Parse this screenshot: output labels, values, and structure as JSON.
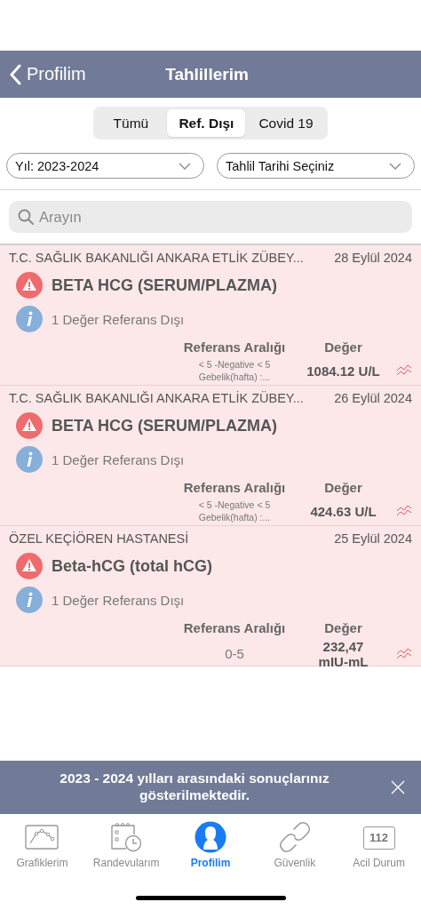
{
  "nav": {
    "back_label": "Profilim",
    "title": "Tahlillerim"
  },
  "segments": [
    {
      "label": "Tümü",
      "selected": false
    },
    {
      "label": "Ref. Dışı",
      "selected": true
    },
    {
      "label": "Covid 19",
      "selected": false
    }
  ],
  "filters": [
    {
      "value": "Yıl: 2023-2024"
    },
    {
      "value": "Tahlil Tarihi Seçiniz"
    }
  ],
  "search": {
    "placeholder": "Arayın"
  },
  "results": [
    {
      "hospital": "T.C. SAĞLIK BAKANLIĞI ANKARA ETLİK ZÜBEY...",
      "date": "28 Eylül 2024",
      "test": "BETA HCG (SERUM/PLAZMA)",
      "note": "1 Değer Referans Dışı",
      "ref_header": "Referans Aralığı",
      "value_header": "Değer",
      "ref_lines": [
        "< 5 -Negative < 5",
        "Gebelik(hafta) :..."
      ],
      "value_lines": [
        "1084.12 U/L"
      ]
    },
    {
      "hospital": "T.C. SAĞLIK BAKANLIĞI ANKARA ETLİK ZÜBEY...",
      "date": "26 Eylül 2024",
      "test": "BETA HCG (SERUM/PLAZMA)",
      "note": "1 Değer Referans Dışı",
      "ref_header": "Referans Aralığı",
      "value_header": "Değer",
      "ref_lines": [
        "< 5 -Negative < 5",
        "Gebelik(hafta) :..."
      ],
      "value_lines": [
        "424.63 U/L"
      ]
    },
    {
      "hospital": "ÖZEL KEÇİÖREN HASTANESİ",
      "date": "25 Eylül 2024",
      "test": "Beta-hCG (total hCG)",
      "note": "1 Değer Referans Dışı",
      "ref_header": "Referans Aralığı",
      "value_header": "Değer",
      "ref_lines": [
        "0-5"
      ],
      "value_lines": [
        "232,47",
        "mIU-mL"
      ]
    }
  ],
  "banner": {
    "message": "2023 - 2024 yılları arasındaki sonuçlarınız gösterilmektedir."
  },
  "tabs": [
    {
      "kind": "chart",
      "label": "Grafiklerim",
      "selected": false
    },
    {
      "kind": "calendar",
      "label": "Randevularım",
      "selected": false
    },
    {
      "kind": "person",
      "label": "Profilim",
      "selected": true
    },
    {
      "kind": "link",
      "label": "Güvenlik",
      "selected": false
    },
    {
      "kind": "emergency",
      "label": "Acil Durum",
      "icon_text": "112",
      "selected": false
    }
  ]
}
